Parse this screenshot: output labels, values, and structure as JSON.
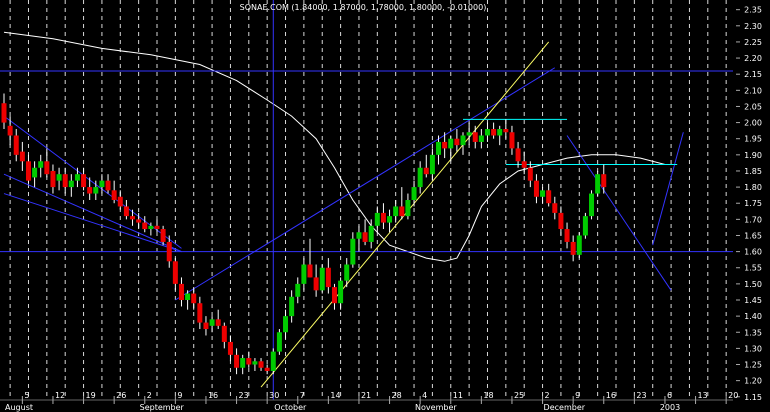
{
  "title": "SONAE.COM (1.84000, 1.87000, 1.78000, 1.80000, -0.01000)",
  "colors": {
    "background": "#000000",
    "up_candle": "#00cc00",
    "down_candle": "#ee0000",
    "wick": "#ffffff",
    "grid": "#ffffff",
    "moving_average": "#ffffff",
    "trendline_blue": "#3333ff",
    "trendline_yellow": "#ffff66",
    "level_cyan": "#00ffff",
    "axis_text": "#ffffff"
  },
  "chart_data": {
    "type": "candlestick",
    "title": "SONAE.COM (1.84000, 1.87000, 1.78000, 1.80000, -0.01000)",
    "ylim": [
      1.14,
      2.38
    ],
    "y_ticks": [
      "1.15",
      "1.20",
      "1.25",
      "1.30",
      "1.35",
      "1.40",
      "1.45",
      "1.50",
      "1.55",
      "1.60",
      "1.65",
      "1.70",
      "1.75",
      "1.80",
      "1.85",
      "1.90",
      "1.95",
      "2.00",
      "2.05",
      "2.10",
      "2.15",
      "2.20",
      "2.25",
      "2.30",
      "2.35"
    ],
    "x_day_labels": [
      {
        "label": "5",
        "i": 3
      },
      {
        "label": "12",
        "i": 8
      },
      {
        "label": "19",
        "i": 13
      },
      {
        "label": "26",
        "i": 18
      },
      {
        "label": "2",
        "i": 23
      },
      {
        "label": "9",
        "i": 28
      },
      {
        "label": "16",
        "i": 33
      },
      {
        "label": "23",
        "i": 38
      },
      {
        "label": "30",
        "i": 43
      },
      {
        "label": "7",
        "i": 48
      },
      {
        "label": "14",
        "i": 53
      },
      {
        "label": "21",
        "i": 58
      },
      {
        "label": "28",
        "i": 63
      },
      {
        "label": "4",
        "i": 68
      },
      {
        "label": "11",
        "i": 73
      },
      {
        "label": "18",
        "i": 78
      },
      {
        "label": "25",
        "i": 83
      },
      {
        "label": "2",
        "i": 88
      },
      {
        "label": "9",
        "i": 93
      },
      {
        "label": "16",
        "i": 98
      },
      {
        "label": "23",
        "i": 103
      },
      {
        "label": "6",
        "i": 108
      },
      {
        "label": "13",
        "i": 113
      },
      {
        "label": "20",
        "i": 118
      }
    ],
    "x_month_labels": [
      {
        "label": "August",
        "i": 0
      },
      {
        "label": "September",
        "i": 22
      },
      {
        "label": "October",
        "i": 44
      },
      {
        "label": "November",
        "i": 67
      },
      {
        "label": "December",
        "i": 88
      },
      {
        "label": "2003",
        "i": 107
      }
    ],
    "candles": [
      [
        2.06,
        2.09,
        1.98,
        2.0
      ],
      [
        1.99,
        2.02,
        1.93,
        1.96
      ],
      [
        1.96,
        1.98,
        1.88,
        1.9
      ],
      [
        1.91,
        1.94,
        1.85,
        1.88
      ],
      [
        1.88,
        1.9,
        1.81,
        1.82
      ],
      [
        1.83,
        1.88,
        1.8,
        1.86
      ],
      [
        1.86,
        1.9,
        1.83,
        1.88
      ],
      [
        1.88,
        1.92,
        1.83,
        1.84
      ],
      [
        1.85,
        1.87,
        1.78,
        1.8
      ],
      [
        1.82,
        1.86,
        1.79,
        1.84
      ],
      [
        1.84,
        1.86,
        1.78,
        1.8
      ],
      [
        1.8,
        1.84,
        1.77,
        1.82
      ],
      [
        1.82,
        1.86,
        1.8,
        1.84
      ],
      [
        1.84,
        1.86,
        1.79,
        1.8
      ],
      [
        1.8,
        1.83,
        1.76,
        1.78
      ],
      [
        1.78,
        1.82,
        1.76,
        1.8
      ],
      [
        1.8,
        1.84,
        1.78,
        1.82
      ],
      [
        1.82,
        1.84,
        1.78,
        1.79
      ],
      [
        1.79,
        1.82,
        1.75,
        1.76
      ],
      [
        1.77,
        1.79,
        1.73,
        1.74
      ],
      [
        1.74,
        1.76,
        1.7,
        1.71
      ],
      [
        1.71,
        1.73,
        1.68,
        1.7
      ],
      [
        1.7,
        1.72,
        1.67,
        1.69
      ],
      [
        1.69,
        1.71,
        1.66,
        1.67
      ],
      [
        1.67,
        1.69,
        1.65,
        1.68
      ],
      [
        1.68,
        1.7,
        1.66,
        1.67
      ],
      [
        1.67,
        1.68,
        1.62,
        1.63
      ],
      [
        1.63,
        1.65,
        1.55,
        1.57
      ],
      [
        1.57,
        1.58,
        1.48,
        1.5
      ],
      [
        1.5,
        1.52,
        1.43,
        1.45
      ],
      [
        1.45,
        1.48,
        1.42,
        1.47
      ],
      [
        1.47,
        1.49,
        1.42,
        1.44
      ],
      [
        1.44,
        1.46,
        1.36,
        1.38
      ],
      [
        1.38,
        1.4,
        1.34,
        1.36
      ],
      [
        1.37,
        1.4,
        1.35,
        1.39
      ],
      [
        1.39,
        1.42,
        1.36,
        1.37
      ],
      [
        1.37,
        1.38,
        1.3,
        1.32
      ],
      [
        1.32,
        1.34,
        1.26,
        1.28
      ],
      [
        1.28,
        1.3,
        1.22,
        1.24
      ],
      [
        1.24,
        1.28,
        1.22,
        1.27
      ],
      [
        1.27,
        1.29,
        1.24,
        1.25
      ],
      [
        1.25,
        1.27,
        1.23,
        1.26
      ],
      [
        1.26,
        1.27,
        1.23,
        1.24
      ],
      [
        1.24,
        1.25,
        1.22,
        1.23
      ],
      [
        1.23,
        1.3,
        1.22,
        1.29
      ],
      [
        1.29,
        1.36,
        1.28,
        1.35
      ],
      [
        1.35,
        1.42,
        1.33,
        1.4
      ],
      [
        1.4,
        1.48,
        1.38,
        1.46
      ],
      [
        1.46,
        1.52,
        1.44,
        1.5
      ],
      [
        1.5,
        1.58,
        1.48,
        1.56
      ],
      [
        1.56,
        1.64,
        1.52,
        1.52
      ],
      [
        1.52,
        1.56,
        1.46,
        1.48
      ],
      [
        1.48,
        1.56,
        1.47,
        1.55
      ],
      [
        1.55,
        1.58,
        1.47,
        1.49
      ],
      [
        1.49,
        1.5,
        1.42,
        1.44
      ],
      [
        1.44,
        1.52,
        1.42,
        1.51
      ],
      [
        1.51,
        1.58,
        1.49,
        1.56
      ],
      [
        1.56,
        1.66,
        1.55,
        1.64
      ],
      [
        1.64,
        1.68,
        1.6,
        1.66
      ],
      [
        1.66,
        1.7,
        1.62,
        1.63
      ],
      [
        1.63,
        1.7,
        1.61,
        1.68
      ],
      [
        1.68,
        1.74,
        1.66,
        1.72
      ],
      [
        1.72,
        1.75,
        1.67,
        1.69
      ],
      [
        1.69,
        1.73,
        1.66,
        1.71
      ],
      [
        1.71,
        1.76,
        1.69,
        1.74
      ],
      [
        1.74,
        1.8,
        1.7,
        1.71
      ],
      [
        1.71,
        1.78,
        1.7,
        1.76
      ],
      [
        1.76,
        1.82,
        1.74,
        1.8
      ],
      [
        1.8,
        1.88,
        1.78,
        1.86
      ],
      [
        1.86,
        1.9,
        1.83,
        1.84
      ],
      [
        1.84,
        1.92,
        1.82,
        1.9
      ],
      [
        1.9,
        1.96,
        1.87,
        1.94
      ],
      [
        1.94,
        1.97,
        1.89,
        1.92
      ],
      [
        1.92,
        1.96,
        1.88,
        1.95
      ],
      [
        1.95,
        1.98,
        1.91,
        1.93
      ],
      [
        1.93,
        1.97,
        1.9,
        1.96
      ],
      [
        1.96,
        2.0,
        1.93,
        1.97
      ],
      [
        1.97,
        1.99,
        1.92,
        1.94
      ],
      [
        1.94,
        1.98,
        1.92,
        1.96
      ],
      [
        1.96,
        2.0,
        1.94,
        1.98
      ],
      [
        1.98,
        2.0,
        1.95,
        1.96
      ],
      [
        1.96,
        1.99,
        1.93,
        1.98
      ],
      [
        1.98,
        2.01,
        1.95,
        1.97
      ],
      [
        1.97,
        1.99,
        1.9,
        1.92
      ],
      [
        1.92,
        1.94,
        1.86,
        1.88
      ],
      [
        1.88,
        1.91,
        1.84,
        1.86
      ],
      [
        1.86,
        1.88,
        1.8,
        1.82
      ],
      [
        1.82,
        1.84,
        1.75,
        1.77
      ],
      [
        1.77,
        1.8,
        1.75,
        1.79
      ],
      [
        1.79,
        1.81,
        1.74,
        1.75
      ],
      [
        1.75,
        1.77,
        1.7,
        1.72
      ],
      [
        1.72,
        1.74,
        1.65,
        1.67
      ],
      [
        1.67,
        1.69,
        1.61,
        1.63
      ],
      [
        1.63,
        1.65,
        1.57,
        1.59
      ],
      [
        1.59,
        1.66,
        1.58,
        1.65
      ],
      [
        1.65,
        1.72,
        1.64,
        1.71
      ],
      [
        1.71,
        1.79,
        1.7,
        1.78
      ],
      [
        1.78,
        1.85,
        1.77,
        1.84
      ],
      [
        1.84,
        1.87,
        1.78,
        1.8
      ]
    ],
    "moving_average": [
      {
        "i": 0,
        "v": 2.28
      },
      {
        "i": 8,
        "v": 2.26
      },
      {
        "i": 16,
        "v": 2.23
      },
      {
        "i": 24,
        "v": 2.21
      },
      {
        "i": 32,
        "v": 2.18
      },
      {
        "i": 38,
        "v": 2.13
      },
      {
        "i": 43,
        "v": 2.07
      },
      {
        "i": 47,
        "v": 2.02
      },
      {
        "i": 51,
        "v": 1.95
      },
      {
        "i": 54,
        "v": 1.86
      },
      {
        "i": 57,
        "v": 1.76
      },
      {
        "i": 60,
        "v": 1.68
      },
      {
        "i": 63,
        "v": 1.62
      },
      {
        "i": 66,
        "v": 1.6
      },
      {
        "i": 69,
        "v": 1.58
      },
      {
        "i": 72,
        "v": 1.57
      },
      {
        "i": 74,
        "v": 1.58
      },
      {
        "i": 76,
        "v": 1.65
      },
      {
        "i": 78,
        "v": 1.74
      },
      {
        "i": 81,
        "v": 1.81
      },
      {
        "i": 84,
        "v": 1.85
      },
      {
        "i": 88,
        "v": 1.87
      },
      {
        "i": 92,
        "v": 1.89
      },
      {
        "i": 96,
        "v": 1.9
      },
      {
        "i": 100,
        "v": 1.9
      },
      {
        "i": 104,
        "v": 1.89
      },
      {
        "i": 108,
        "v": 1.87
      }
    ],
    "grid_every": 3,
    "lines": [
      {
        "kind": "horizontal",
        "color": "blue",
        "v": 2.16
      },
      {
        "kind": "horizontal",
        "color": "blue",
        "v": 1.6
      },
      {
        "kind": "vertical",
        "color": "blue",
        "i": 44
      },
      {
        "kind": "segment",
        "color": "blue",
        "i1": 0,
        "v1": 2.02,
        "i2": 29,
        "v2": 1.61
      },
      {
        "kind": "segment",
        "color": "blue",
        "i1": 0,
        "v1": 1.84,
        "i2": 29,
        "v2": 1.6
      },
      {
        "kind": "segment",
        "color": "blue",
        "i1": 0,
        "v1": 1.78,
        "i2": 29,
        "v2": 1.6
      },
      {
        "kind": "segment",
        "color": "blue",
        "i1": 28,
        "v1": 1.45,
        "i2": 90,
        "v2": 2.17
      },
      {
        "kind": "segment",
        "color": "blue",
        "i1": 92,
        "v1": 1.96,
        "i2": 109,
        "v2": 1.48
      },
      {
        "kind": "segment",
        "color": "blue",
        "i1": 106,
        "v1": 1.62,
        "i2": 111,
        "v2": 1.97
      },
      {
        "kind": "segment",
        "color": "yellow",
        "i1": 42,
        "v1": 1.18,
        "i2": 89,
        "v2": 2.25
      },
      {
        "kind": "segment",
        "color": "cyan",
        "i1": 75,
        "v1": 2.01,
        "i2": 92,
        "v2": 2.01
      },
      {
        "kind": "segment",
        "color": "cyan",
        "i1": 82,
        "v1": 1.87,
        "i2": 110,
        "v2": 1.87
      }
    ]
  }
}
